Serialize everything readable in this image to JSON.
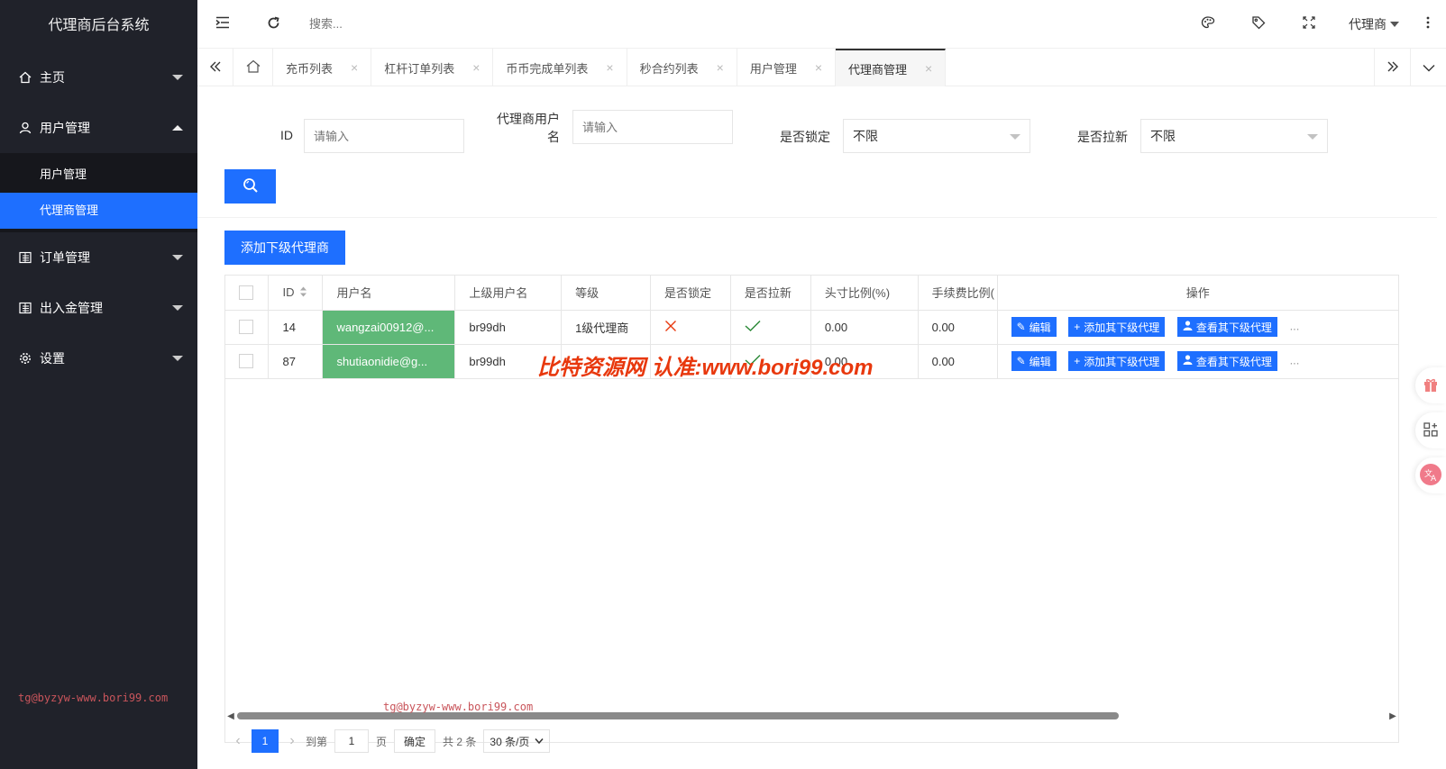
{
  "app": {
    "title": "代理商后台系统"
  },
  "sidebar": {
    "items": [
      {
        "label": "主页",
        "icon": "home-icon"
      },
      {
        "label": "用户管理",
        "icon": "user-icon",
        "expanded": true,
        "children": [
          {
            "label": "用户管理"
          },
          {
            "label": "代理商管理",
            "active": true
          }
        ]
      },
      {
        "label": "订单管理",
        "icon": "list-icon"
      },
      {
        "label": "出入金管理",
        "icon": "list-icon"
      },
      {
        "label": "设置",
        "icon": "gear-icon"
      }
    ],
    "watermark": "tg@byzyw-www.bori99.com"
  },
  "header": {
    "search_placeholder": "搜索...",
    "user": "代理商"
  },
  "tabs": [
    {
      "label": "充币列表"
    },
    {
      "label": "杠杆订单列表"
    },
    {
      "label": "币币完成单列表"
    },
    {
      "label": "秒合约列表"
    },
    {
      "label": "用户管理"
    },
    {
      "label": "代理商管理",
      "active": true
    }
  ],
  "filters": {
    "id_label": "ID",
    "id_placeholder": "请输入",
    "agent_label_1": "代理商用户",
    "agent_label_2": "名",
    "agent_placeholder": "请输入",
    "locked_label": "是否锁定",
    "locked_value": "不限",
    "pull_label": "是否拉新",
    "pull_value": "不限"
  },
  "add_button": "添加下级代理商",
  "table": {
    "headers": [
      "ID",
      "用户名",
      "上级用户名",
      "等级",
      "是否锁定",
      "是否拉新",
      "头寸比例(%)",
      "手续费比例(",
      "操作"
    ],
    "rows": [
      {
        "id": "14",
        "username": "wangzai00912@...",
        "parent": "br99dh",
        "level": "1级代理商",
        "locked": false,
        "pull": true,
        "position": "0.00",
        "fee": "0.00"
      },
      {
        "id": "87",
        "username": "shutiaonidie@g...",
        "parent": "br99dh",
        "level": "",
        "locked": false,
        "pull": true,
        "position": "0.00",
        "fee": "0.00"
      }
    ],
    "ops": {
      "edit": "编辑",
      "add_sub": "添加其下级代理",
      "view_sub": "查看其下级代理",
      "more": "..."
    }
  },
  "pager": {
    "current": "1",
    "goto_label": "到第",
    "goto_value": "1",
    "page_label": "页",
    "confirm": "确定",
    "total": "共 2 条",
    "per_page": "30 条/页"
  },
  "overlay_watermark": "比特资源网 认准:www.bori99.com",
  "content_watermark": "tg@byzyw-www.bori99.com",
  "colors": {
    "primary": "#1e6fff",
    "sidebar": "#20222a",
    "green": "#5fb878",
    "red": "#e8380d"
  }
}
